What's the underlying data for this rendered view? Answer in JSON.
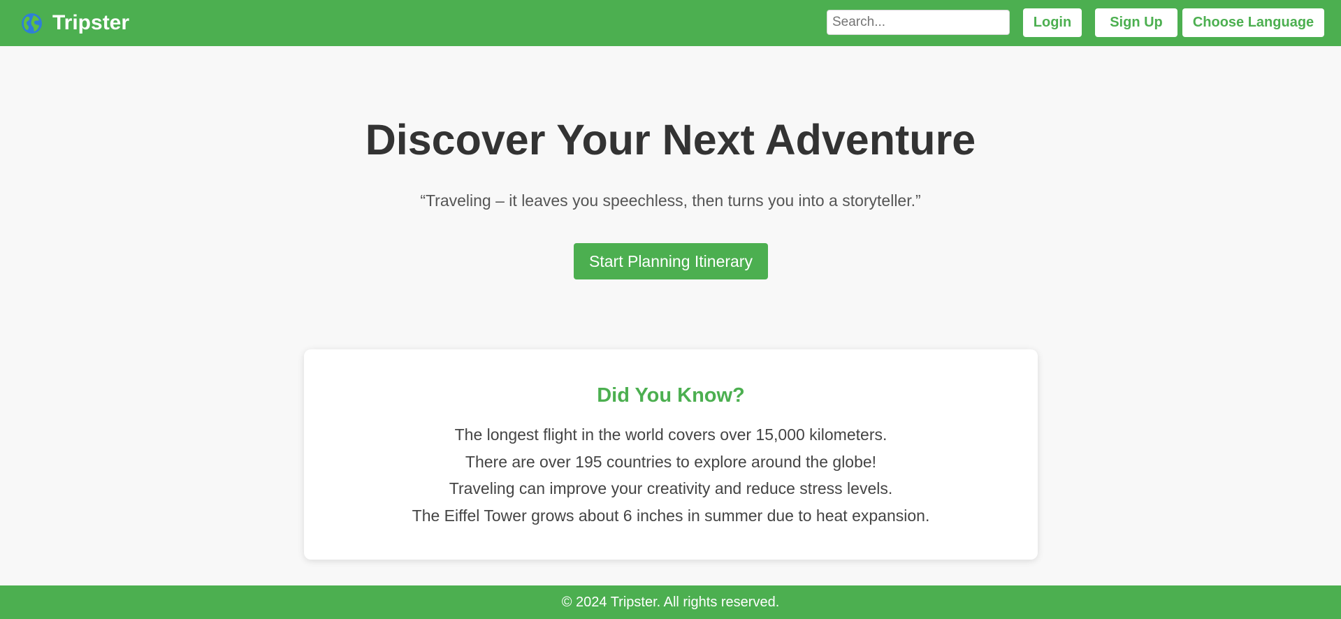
{
  "header": {
    "brand_icon": "globe-icon",
    "brand_name": "Tripster",
    "search": {
      "placeholder": "Search...",
      "value": ""
    },
    "login_label": "Login",
    "signup_label": "Sign Up",
    "language_label": "Choose Language"
  },
  "hero": {
    "title": "Discover Your Next Adventure",
    "quote": "“Traveling – it leaves you speechless, then turns you into a storyteller.”",
    "cta_label": "Start Planning Itinerary"
  },
  "facts": {
    "heading": "Did You Know?",
    "items": [
      "The longest flight in the world covers over 15,000 kilometers.",
      "There are over 195 countries to explore around the globe!",
      "Traveling can improve your creativity and reduce stress levels.",
      "The Eiffel Tower grows about 6 inches in summer due to heat expansion."
    ]
  },
  "footer": {
    "text": "© 2024 Tripster. All rights reserved."
  },
  "colors": {
    "brand_green": "#4caf50",
    "page_background": "#f8f8f8",
    "text_dark": "#333333"
  }
}
